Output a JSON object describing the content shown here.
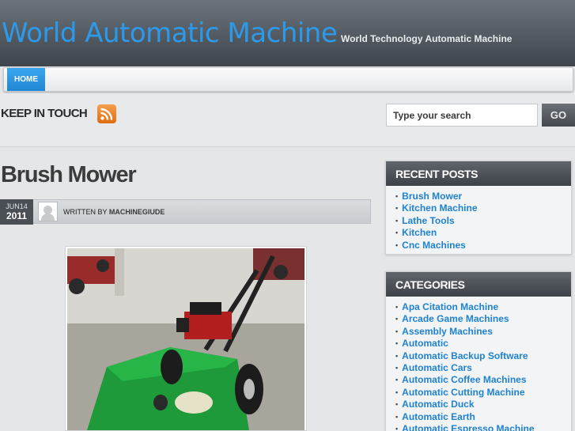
{
  "header": {
    "site_title": "World Automatic Machine",
    "tagline": "World Technology Automatic Machine"
  },
  "nav": {
    "items": [
      {
        "label": "HOME",
        "active": true
      }
    ]
  },
  "topbar": {
    "keep_in_touch": "KEEP IN TOUCH",
    "rss_icon": "rss-icon",
    "search_placeholder": "Type your search",
    "go_label": "GO"
  },
  "post": {
    "title": "Brush Mower",
    "date_month_day": "JUN14",
    "date_year": "2011",
    "written_by_label": "WRITTEN BY",
    "author": "MACHINEGIUDE",
    "image_icon": "brush-mower-photo"
  },
  "sidebar": {
    "recent_posts": {
      "title": "RECENT POSTS",
      "items": [
        "Brush Mower",
        "Kitchen Machine",
        "Lathe Tools",
        "Kitchen",
        "Cnc Machines"
      ]
    },
    "categories": {
      "title": "CATEGORIES",
      "items": [
        "Apa Citation Machine",
        "Arcade Game Machines",
        "Assembly Machines",
        "Automatic",
        "Automatic Backup Software",
        "Automatic Cars",
        "Automatic Coffee Machines",
        "Automatic Cutting Machine",
        "Automatic Duck",
        "Automatic Earth",
        "Automatic Espresso Machine"
      ]
    }
  },
  "colors": {
    "accent": "#1f82d0",
    "title_blue": "#2b9aeb",
    "header_dark": "#3f454c"
  }
}
